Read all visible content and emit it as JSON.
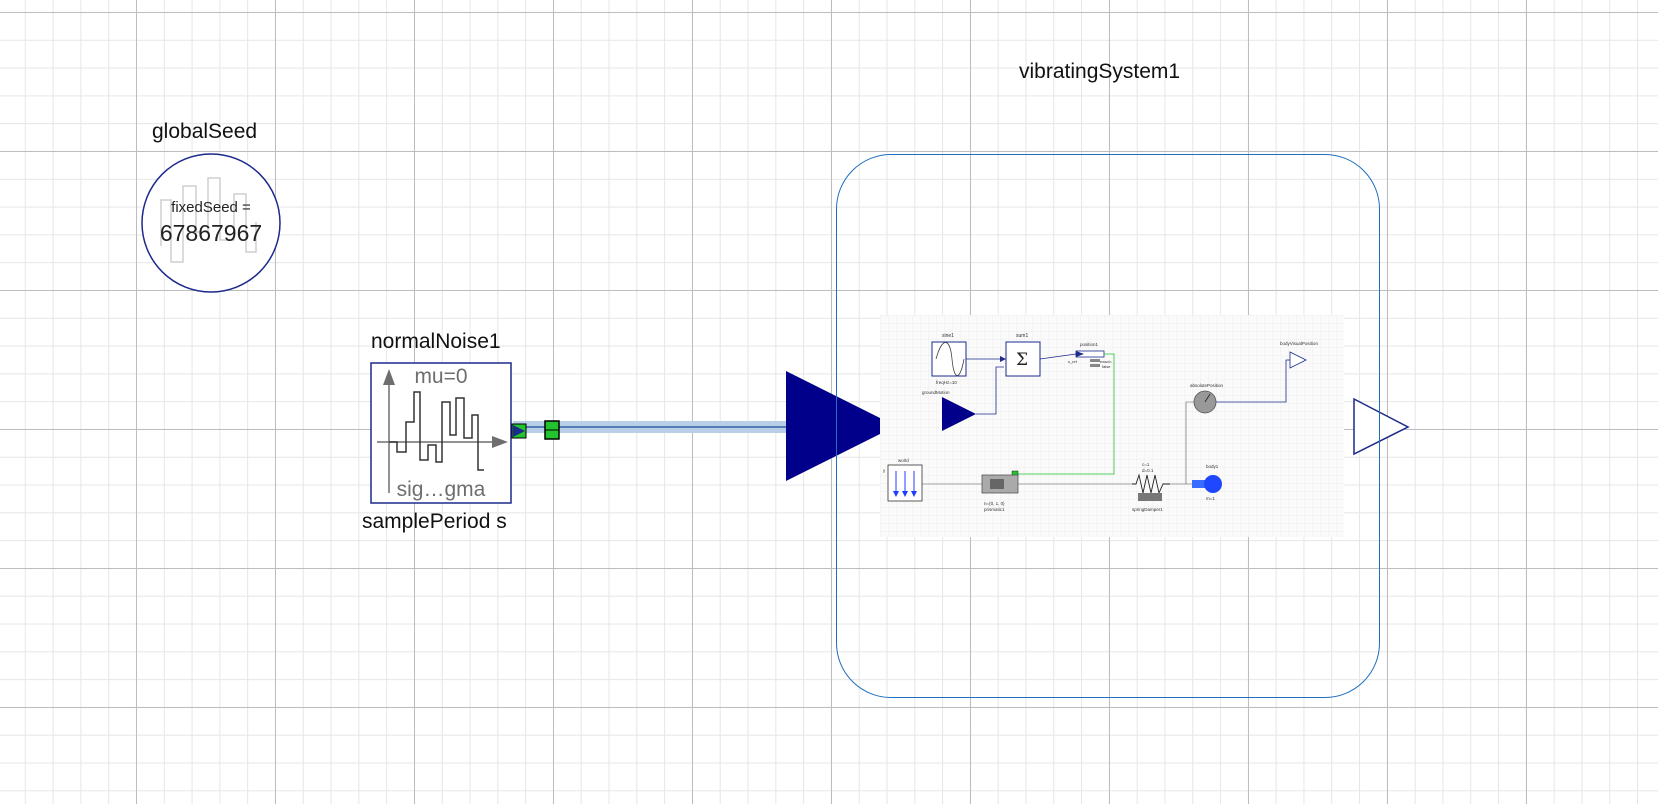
{
  "global_seed": {
    "title": "globalSeed",
    "seed_label": "fixedSeed =",
    "seed_value": "67867967"
  },
  "normal_noise": {
    "title": "normalNoise1",
    "mu_label": "mu=0",
    "sigma_label": "sig…gma",
    "period_label": "samplePeriod s"
  },
  "vibrating_system": {
    "title": "vibratingSystem1",
    "inner": {
      "sine_title": "sine1",
      "sine_param": "freqHz=10",
      "sine_caption": "groundMotion",
      "sum_title": "sum1",
      "sum_symbol": "Σ",
      "position_title": "position1",
      "position_param1": "exact=",
      "position_param2": "false",
      "position_port": "s_ref",
      "output_title": "bodyVisualPosition",
      "sensor_title": "absolutePosition",
      "world_title": "world",
      "world_axis": "y",
      "prismatic_title": "prismatic1",
      "prismatic_param": "n={0, 1, 0}",
      "spring_title": "springDamper1",
      "spring_param1": "c=1",
      "spring_param2": "d=0.1",
      "body_title": "body1",
      "body_param": "m=1"
    }
  },
  "colors": {
    "connector_blue": "#00008b",
    "frame_blue": "#1f6fbf",
    "connection_highlight": "#b9cfe8",
    "port_green": "#22c32e",
    "label_gray": "#6e6e6e"
  }
}
